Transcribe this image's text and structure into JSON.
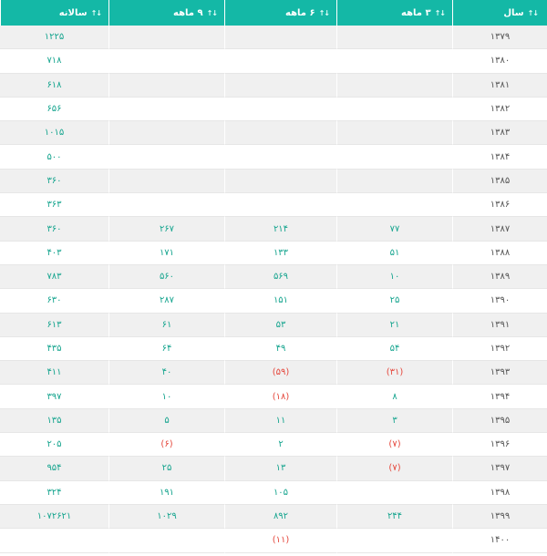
{
  "colors": {
    "header_bg": "#14b8a6",
    "positive": "#17a58f",
    "negative": "#e5483d",
    "stripe": "#f0f0f0"
  },
  "table": {
    "headers": [
      {
        "label": "سال",
        "icon": "sort-asc-icon"
      },
      {
        "label": "۳ ماهه",
        "icon": "sort-icon"
      },
      {
        "label": "۶ ماهه",
        "icon": "sort-icon"
      },
      {
        "label": "۹ ماهه",
        "icon": "sort-icon"
      },
      {
        "label": "سالانه",
        "icon": "sort-icon"
      }
    ],
    "rows": [
      {
        "year": "۱۳۷۹",
        "m3": "",
        "m6": "",
        "m9": "",
        "annual": "۱۲۲۵"
      },
      {
        "year": "۱۳۸۰",
        "m3": "",
        "m6": "",
        "m9": "",
        "annual": "۷۱۸"
      },
      {
        "year": "۱۳۸۱",
        "m3": "",
        "m6": "",
        "m9": "",
        "annual": "۶۱۸"
      },
      {
        "year": "۱۳۸۲",
        "m3": "",
        "m6": "",
        "m9": "",
        "annual": "۶۵۶"
      },
      {
        "year": "۱۳۸۳",
        "m3": "",
        "m6": "",
        "m9": "",
        "annual": "۱۰۱۵"
      },
      {
        "year": "۱۳۸۴",
        "m3": "",
        "m6": "",
        "m9": "",
        "annual": "۵۰۰"
      },
      {
        "year": "۱۳۸۵",
        "m3": "",
        "m6": "",
        "m9": "",
        "annual": "۳۶۰"
      },
      {
        "year": "۱۳۸۶",
        "m3": "",
        "m6": "",
        "m9": "",
        "annual": "۳۶۳"
      },
      {
        "year": "۱۳۸۷",
        "m3": "۷۷",
        "m6": "۲۱۴",
        "m9": "۲۶۷",
        "annual": "۳۶۰"
      },
      {
        "year": "۱۳۸۸",
        "m3": "۵۱",
        "m6": "۱۳۳",
        "m9": "۱۷۱",
        "annual": "۴۰۳"
      },
      {
        "year": "۱۳۸۹",
        "m3": "۱۰",
        "m6": "۵۶۹",
        "m9": "۵۶۰",
        "annual": "۷۸۳"
      },
      {
        "year": "۱۳۹۰",
        "m3": "۲۵",
        "m6": "۱۵۱",
        "m9": "۲۸۷",
        "annual": "۶۳۰"
      },
      {
        "year": "۱۳۹۱",
        "m3": "۲۱",
        "m6": "۵۳",
        "m9": "۶۱",
        "annual": "۶۱۳"
      },
      {
        "year": "۱۳۹۲",
        "m3": "۵۴",
        "m6": "۴۹",
        "m9": "۶۴",
        "annual": "۴۳۵"
      },
      {
        "year": "۱۳۹۳",
        "m3": "(۳۱)",
        "m6": "(۵۹)",
        "m9": "۴۰",
        "annual": "۴۱۱"
      },
      {
        "year": "۱۳۹۴",
        "m3": "۸",
        "m6": "(۱۸)",
        "m9": "۱۰",
        "annual": "۳۹۷"
      },
      {
        "year": "۱۳۹۵",
        "m3": "۳",
        "m6": "۱۱",
        "m9": "۵",
        "annual": "۱۳۵"
      },
      {
        "year": "۱۳۹۶",
        "m3": "(۷)",
        "m6": "۲",
        "m9": "(۶)",
        "annual": "۲۰۵"
      },
      {
        "year": "۱۳۹۷",
        "m3": "(۷)",
        "m6": "۱۳",
        "m9": "۲۵",
        "annual": "۹۵۴"
      },
      {
        "year": "۱۳۹۸",
        "m3": "",
        "m6": "۱۰۵",
        "m9": "۱۹۱",
        "annual": "۳۲۴"
      },
      {
        "year": "۱۳۹۹",
        "m3": "۲۴۴",
        "m6": "۸۹۲",
        "m9": "۱۰۲۹",
        "annual": "۱۰۷۲۶۲۱"
      },
      {
        "year": "۱۴۰۰",
        "m3": "",
        "m6": "(۱۱)",
        "m9": "",
        "annual": ""
      }
    ]
  }
}
